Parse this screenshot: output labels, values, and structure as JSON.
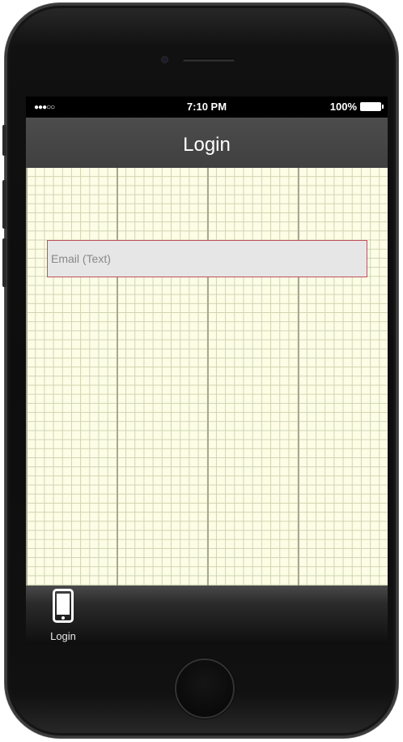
{
  "status_bar": {
    "signal": "●●●○○",
    "time": "7:10 PM",
    "battery": "100%"
  },
  "nav": {
    "title": "Login"
  },
  "form": {
    "email_placeholder": "Email (Text)",
    "email_value": ""
  },
  "tab_bar": {
    "items": [
      {
        "label": "Login",
        "icon": "phone-icon"
      }
    ]
  },
  "colors": {
    "nav_background": "#444444",
    "content_background": "#fdfde6",
    "grid_line": "#cfd4b1",
    "field_border": "#c0505a",
    "field_background": "#e6e6e6"
  }
}
